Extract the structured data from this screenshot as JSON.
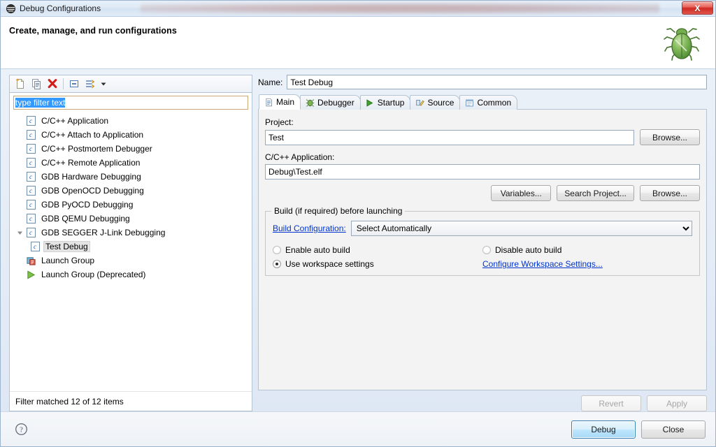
{
  "window": {
    "title": "Debug Configurations",
    "title_icon": "eclipse-debug-icon",
    "close_label": "X"
  },
  "header": {
    "title": "Create, manage, and run configurations",
    "banner_icon": "green-bug-icon"
  },
  "tree_toolbar": {
    "buttons": [
      {
        "name": "new-launch-configuration-icon",
        "title": "New launch configuration"
      },
      {
        "name": "duplicate-launch-configuration-icon",
        "title": "Duplicate"
      },
      {
        "name": "delete-launch-configuration-icon",
        "title": "Delete"
      },
      {
        "name": "collapse-all-icon",
        "title": "Collapse All"
      },
      {
        "name": "filter-launch-configurations-icon",
        "title": "Filter"
      }
    ],
    "dropdown_icon": "chevron-down-icon"
  },
  "filter": {
    "value": "type filter text",
    "placeholder": "type filter text"
  },
  "tree": {
    "items": [
      {
        "label": "C/C++ Application",
        "icon": "c-config-icon",
        "level": 0,
        "expandable": false,
        "selected": false
      },
      {
        "label": "C/C++ Attach to Application",
        "icon": "c-config-icon",
        "level": 0,
        "expandable": false,
        "selected": false
      },
      {
        "label": "C/C++ Postmortem Debugger",
        "icon": "c-config-icon",
        "level": 0,
        "expandable": false,
        "selected": false
      },
      {
        "label": "C/C++ Remote Application",
        "icon": "c-config-icon",
        "level": 0,
        "expandable": false,
        "selected": false
      },
      {
        "label": "GDB Hardware Debugging",
        "icon": "c-config-icon",
        "level": 0,
        "expandable": false,
        "selected": false
      },
      {
        "label": "GDB OpenOCD Debugging",
        "icon": "c-config-icon",
        "level": 0,
        "expandable": false,
        "selected": false
      },
      {
        "label": "GDB PyOCD Debugging",
        "icon": "c-config-icon",
        "level": 0,
        "expandable": false,
        "selected": false
      },
      {
        "label": "GDB QEMU Debugging",
        "icon": "c-config-icon",
        "level": 0,
        "expandable": false,
        "selected": false
      },
      {
        "label": "GDB SEGGER J-Link Debugging",
        "icon": "c-config-icon",
        "level": 0,
        "expandable": true,
        "expanded": true,
        "selected": false
      },
      {
        "label": "Test Debug",
        "icon": "c-config-icon",
        "level": 1,
        "expandable": false,
        "selected": true
      },
      {
        "label": "Launch Group",
        "icon": "launch-group-icon",
        "level": 0,
        "expandable": false,
        "selected": false
      },
      {
        "label": "Launch Group (Deprecated)",
        "icon": "launch-group-deprecated-icon",
        "level": 0,
        "expandable": false,
        "selected": false
      }
    ],
    "status": "Filter matched 12 of 12 items"
  },
  "config": {
    "name_label": "Name:",
    "name_value": "Test Debug",
    "tabs": [
      {
        "label": "Main",
        "icon": "document-icon",
        "active": true
      },
      {
        "label": "Debugger",
        "icon": "debugger-icon",
        "active": false
      },
      {
        "label": "Startup",
        "icon": "play-icon",
        "active": false
      },
      {
        "label": "Source",
        "icon": "source-lookup-icon",
        "active": false
      },
      {
        "label": "Common",
        "icon": "common-icon",
        "active": false
      }
    ],
    "project_label": "Project:",
    "project_value": "Test",
    "project_browse_label": "Browse...",
    "application_label": "C/C++ Application:",
    "application_value": "Debug\\Test.elf",
    "app_variables_label": "Variables...",
    "app_search_project_label": "Search Project...",
    "app_browse_label": "Browse...",
    "build_group_title": "Build (if required) before launching",
    "build_configuration_label": "Build Configuration:",
    "build_configuration_value": "Select Automatically",
    "build_configuration_options": [
      "Select Automatically"
    ],
    "radio_enable_auto_build": "Enable auto build",
    "radio_disable_auto_build": "Disable auto build",
    "radio_use_workspace_settings": "Use workspace settings",
    "configure_workspace_link": "Configure Workspace Settings...",
    "selected_build_option": "Use workspace settings",
    "revert_label": "Revert",
    "apply_label": "Apply",
    "revert_enabled": false,
    "apply_enabled": false
  },
  "footer": {
    "help_icon": "help-question-icon",
    "debug_label": "Debug",
    "close_label": "Close",
    "default_button": "Debug"
  },
  "colors": {
    "accent_blue": "#3c7fb1",
    "link_blue": "#0033cc",
    "selection_blue": "#3399ff",
    "close_red": "#cf2a21",
    "bug_green": "#6aa84f"
  }
}
